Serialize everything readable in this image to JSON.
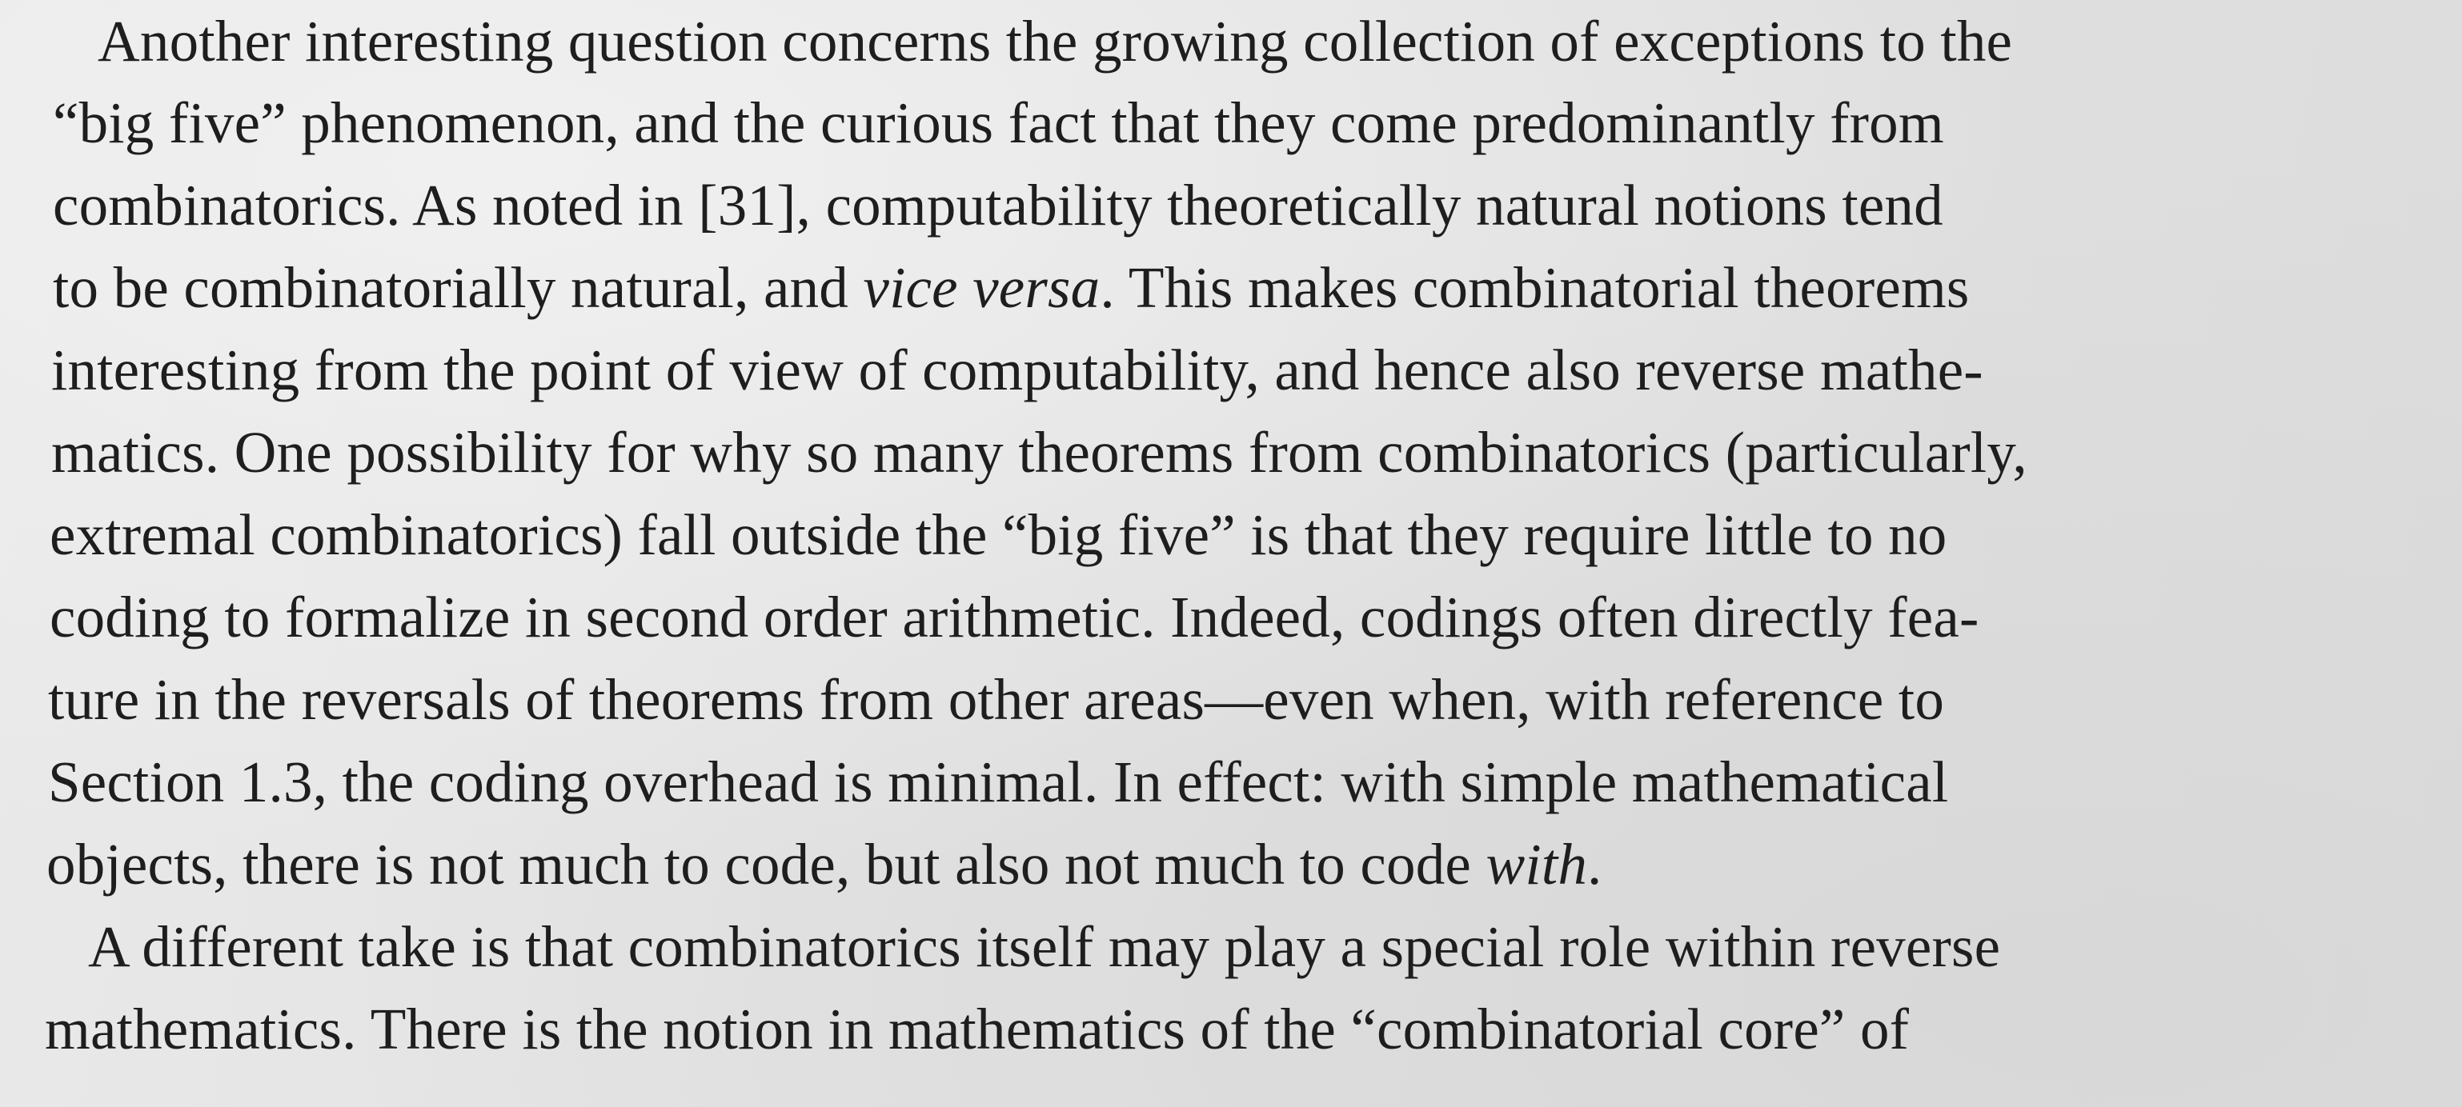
{
  "paragraphs": [
    {
      "lines": [
        "Another interesting question concerns the growing collection of exceptions to the",
        "“big five” phenomenon, and the curious fact that they come predominantly from",
        "combinatorics. As noted in [31], computability theoretically natural notions tend",
        "to be combinatorially natural, and vice versa. This makes combinatorial theorems",
        "interesting from the point of view of computability, and hence also reverse mathe-",
        "matics. One possibility for why so many theorems from combinatorics (particularly,",
        "extremal combinatorics) fall outside the “big five” is that they require little to no",
        "coding to formalize in second order arithmetic. Indeed, codings often directly fea-",
        "ture in the reversals of theorems from other areas—even when, with reference to",
        "Section 1.3, the coding overhead is minimal. In effect: with simple mathematical",
        "objects, there is not much to code, but also not much to code with."
      ]
    },
    {
      "lines": [
        "A different take is that combinatorics itself may play a special role within reverse",
        "mathematics. There is the notion in mathematics of the “combinatorial core” of"
      ]
    }
  ],
  "italic_phrases": [
    "vice versa",
    "with"
  ]
}
